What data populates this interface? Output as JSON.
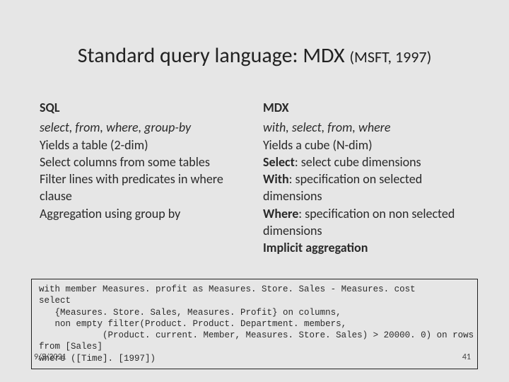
{
  "title": {
    "main": "Standard query language: MDX ",
    "sub": "(MSFT, 1997)"
  },
  "left": {
    "heading": "SQL",
    "line1": "select, from, where, group-by",
    "body": "Yields a table (2-dim)\nSelect columns from some tables\nFilter lines with predicates in where clause\nAggregation using group by"
  },
  "right": {
    "heading": "MDX",
    "line1": "with, select, from, where",
    "l2a": "Yields a cube (N-dim)",
    "l3a": "Select",
    "l3b": ": select cube dimensions",
    "l4a": "With",
    "l4b": ": specification on selected dimensions",
    "l5a": "Where",
    "l5b": ": specification on non selected dimensions",
    "l6a": "Implicit aggregation"
  },
  "code": "with member Measures. profit as Measures. Store. Sales - Measures. cost\nselect\n   {Measures. Store. Sales, Measures. Profit} on columns,\n   non empty filter(Product. Product. Department. members,\n            (Product. current. Member, Measures. Store. Sales) > 20000. 0) on rows\nfrom [Sales]\nwhere ([Time]. [1997])",
  "footer": {
    "date": "9/5/2021",
    "page": "41"
  }
}
